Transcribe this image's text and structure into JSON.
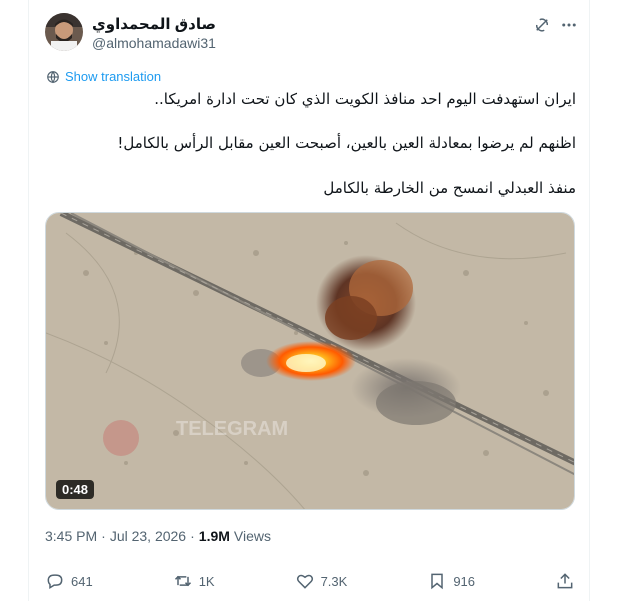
{
  "author": {
    "display_name": "صادق المحمداوي",
    "handle": "@almohamadawi31"
  },
  "translate_label": "Show translation",
  "tweet_lines": [
    "ايران استهدفت اليوم احد منافذ الكويت الذي كان تحت ادارة امريكا..",
    "اظنهم لم يرضوا بمعادلة العين بالعين، أصبحت العين مقابل الرأس بالكامل!",
    "منفذ العبدلي انمسح من الخارطة بالكامل"
  ],
  "media": {
    "duration": "0:48",
    "watermark": "TELEGRAM"
  },
  "meta": {
    "time": "3:45 PM",
    "separator": "·",
    "date": "Jul 23, 2026",
    "views_count": "1.9M",
    "views_label": "Views"
  },
  "actions": {
    "replies": "641",
    "reposts": "1K",
    "likes": "7.3K",
    "bookmarks": "916"
  },
  "icons": [
    "grok-icon",
    "more-icon",
    "translate-icon",
    "reply-icon",
    "repost-icon",
    "like-icon",
    "bookmark-icon",
    "share-icon"
  ],
  "colors": {
    "accent": "#1d9bf0",
    "secondary_text": "#536471",
    "primary_text": "#0f1419"
  }
}
